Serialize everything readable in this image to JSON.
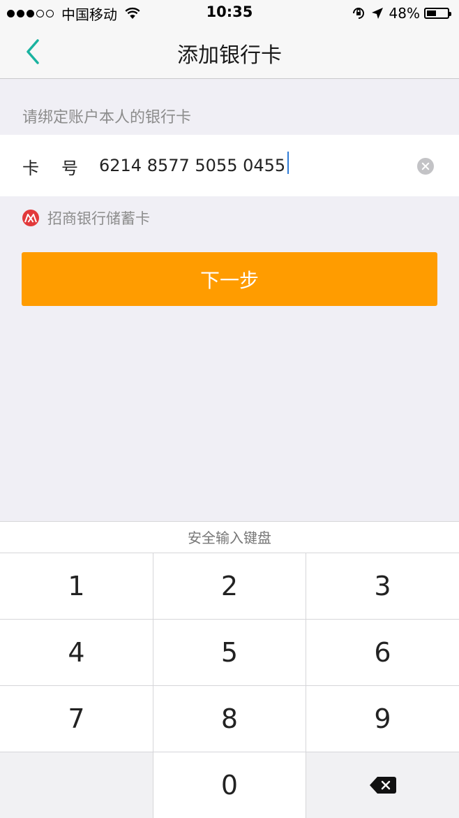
{
  "status_bar": {
    "carrier": "中国移动",
    "time": "10:35",
    "battery": "48%",
    "battery_level": 0.48
  },
  "nav": {
    "title": "添加银行卡"
  },
  "form": {
    "hint": "请绑定账户本人的银行卡",
    "card_label_1": "卡",
    "card_label_2": "号",
    "card_number": "6214 8577 5055 0455",
    "bank_name": "招商银行储蓄卡"
  },
  "next_button": "下一步",
  "keyboard": {
    "title": "安全输入键盘",
    "keys": [
      "1",
      "2",
      "3",
      "4",
      "5",
      "6",
      "7",
      "8",
      "9",
      "",
      "0",
      "delete"
    ]
  },
  "colors": {
    "accent": "#1ab3a0",
    "button": "#ff9c00",
    "bank_logo": "#e2393b"
  }
}
